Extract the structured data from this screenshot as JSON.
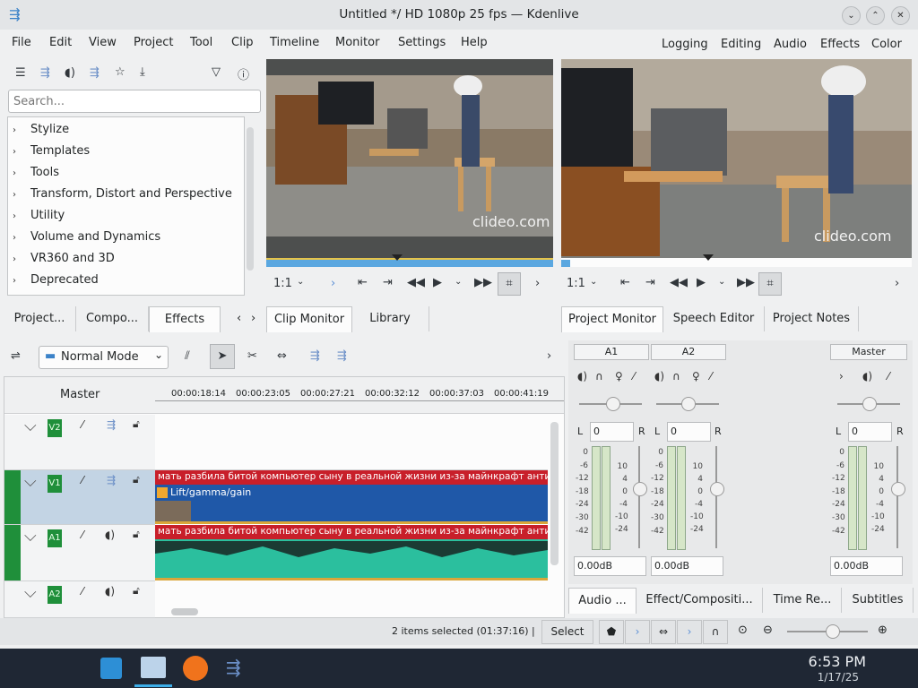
{
  "window": {
    "title": "Untitled */ HD 1080p 25 fps — Kdenlive"
  },
  "menu": [
    "File",
    "Edit",
    "View",
    "Project",
    "Tool",
    "Clip",
    "Timeline",
    "Monitor",
    "Settings",
    "Help"
  ],
  "workspaces": [
    "Logging",
    "Editing",
    "Audio",
    "Effects",
    "Color"
  ],
  "effects": {
    "search_placeholder": "Search...",
    "items": [
      "Stylize",
      "Templates",
      "Tools",
      "Transform, Distort and Perspective",
      "Utility",
      "Volume and Dynamics",
      "VR360 and 3D",
      "Deprecated"
    ]
  },
  "left_tabs": [
    "Project...",
    "Compo...",
    "Effects"
  ],
  "clip_tabs": [
    "Clip Monitor",
    "Library"
  ],
  "project_tabs": [
    "Project Monitor",
    "Speech Editor",
    "Project Notes"
  ],
  "monitor": {
    "watermark": "clideo.com",
    "zoom": "1:1"
  },
  "timeline": {
    "mode": "Normal Mode",
    "master_label": "Master",
    "ruler": [
      "00:00:18:14",
      "00:00:23:05",
      "00:00:27:21",
      "00:00:32:12",
      "00:00:37:03",
      "00:00:41:19"
    ],
    "tracks": [
      "V2",
      "V1",
      "A1",
      "A2"
    ],
    "clip_title": "мать разбила битой компьютер сыну в реальной жизни из-за майнкрафт анти-гр",
    "effect_label": "Lift/gamma/gain"
  },
  "mixer": {
    "channels": [
      "A1",
      "A2",
      "Master"
    ],
    "lr": [
      "L",
      "R"
    ],
    "pan_value": "0",
    "db_value": "0.00dB",
    "meter_scale": [
      "0",
      "-6",
      "-12",
      "-18",
      "-24",
      "-30",
      "-42"
    ],
    "fader_scale": [
      "10",
      "4",
      "0",
      "-4",
      "-10",
      "-24"
    ]
  },
  "bottom_tabs": [
    "Audio ...",
    "Effect/Compositi...",
    "Time Re...",
    "Subtitles"
  ],
  "status": {
    "selection": "2 items selected (01:37:16)  |",
    "select_label": "Select"
  },
  "clock": {
    "time": "6:53 PM",
    "date": "1/17/25"
  }
}
